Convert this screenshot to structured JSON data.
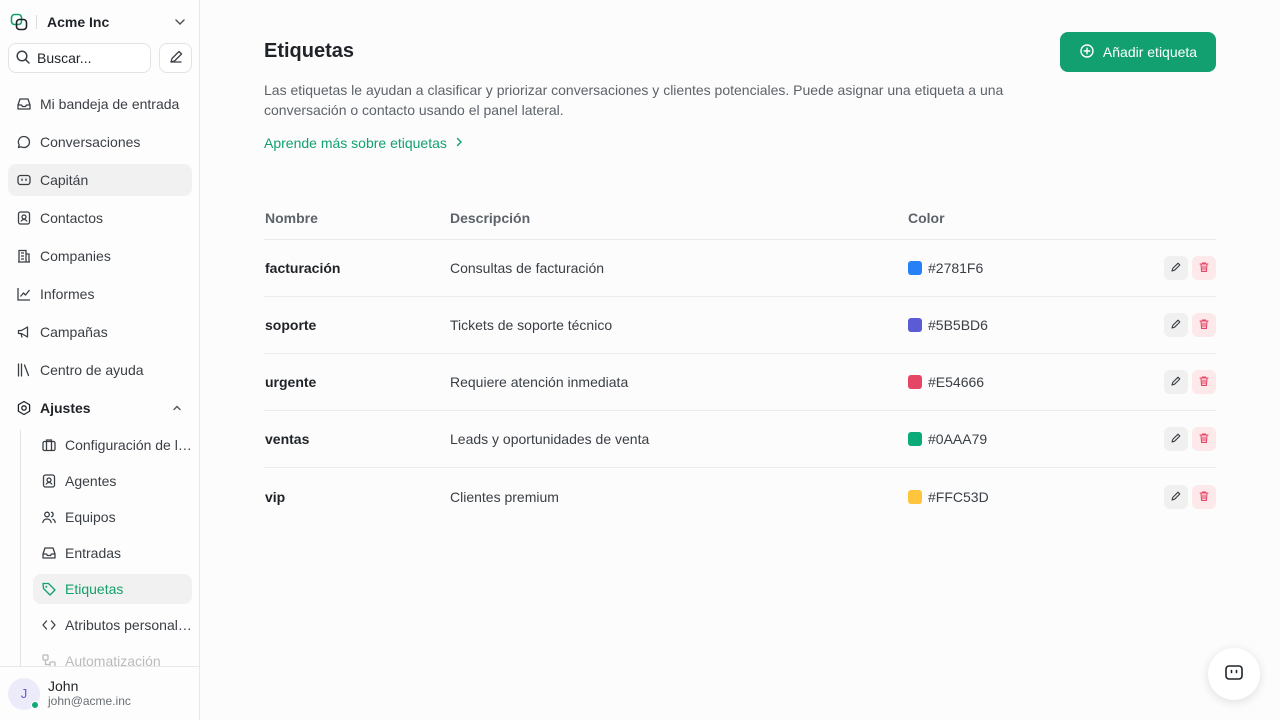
{
  "account": {
    "name": "Acme Inc"
  },
  "search": {
    "placeholder": "Buscar..."
  },
  "sidebar": {
    "items": [
      {
        "label": "Mi bandeja de entrada",
        "icon": "inbox-icon"
      },
      {
        "label": "Conversaciones",
        "icon": "chat-bubble-icon"
      },
      {
        "label": "Capitán",
        "icon": "bot-icon"
      },
      {
        "label": "Contactos",
        "icon": "contact-card-icon"
      },
      {
        "label": "Companies",
        "icon": "building-icon"
      },
      {
        "label": "Informes",
        "icon": "chart-line-icon"
      },
      {
        "label": "Campañas",
        "icon": "megaphone-icon"
      },
      {
        "label": "Centro de ayuda",
        "icon": "library-icon"
      },
      {
        "label": "Ajustes",
        "icon": "gear-icon"
      }
    ],
    "settings_items": [
      {
        "label": "Configuración de la cuenta",
        "icon": "briefcase-icon"
      },
      {
        "label": "Agentes",
        "icon": "contact-card-icon"
      },
      {
        "label": "Equipos",
        "icon": "users-icon"
      },
      {
        "label": "Entradas",
        "icon": "inbox-icon"
      },
      {
        "label": "Etiquetas",
        "icon": "tag-icon"
      },
      {
        "label": "Atributos personalizados",
        "icon": "code-icon"
      },
      {
        "label": "Automatización",
        "icon": "workflow-icon"
      }
    ]
  },
  "user": {
    "initial": "J",
    "name": "John",
    "email": "john@acme.inc"
  },
  "page": {
    "title": "Etiquetas",
    "add_label": "Añadir etiqueta",
    "description": "Las etiquetas le ayudan a clasificar y priorizar conversaciones y clientes potenciales. Puede asignar una etiqueta a una conversación o contacto usando el panel lateral.",
    "learn_more": "Aprende más sobre etiquetas"
  },
  "table": {
    "headers": {
      "name": "Nombre",
      "description": "Descripción",
      "color": "Color"
    },
    "rows": [
      {
        "name": "facturación",
        "description": "Consultas de facturación",
        "color": "#2781F6"
      },
      {
        "name": "soporte",
        "description": "Tickets de soporte técnico",
        "color": "#5B5BD6"
      },
      {
        "name": "urgente",
        "description": "Requiere atención inmediata",
        "color": "#E54666"
      },
      {
        "name": "ventas",
        "description": "Leads y oportunidades de venta",
        "color": "#0AAA79"
      },
      {
        "name": "vip",
        "description": "Clientes premium",
        "color": "#FFC53D"
      }
    ]
  },
  "colors": {
    "accent": "#12A071",
    "danger": "#E54666"
  }
}
